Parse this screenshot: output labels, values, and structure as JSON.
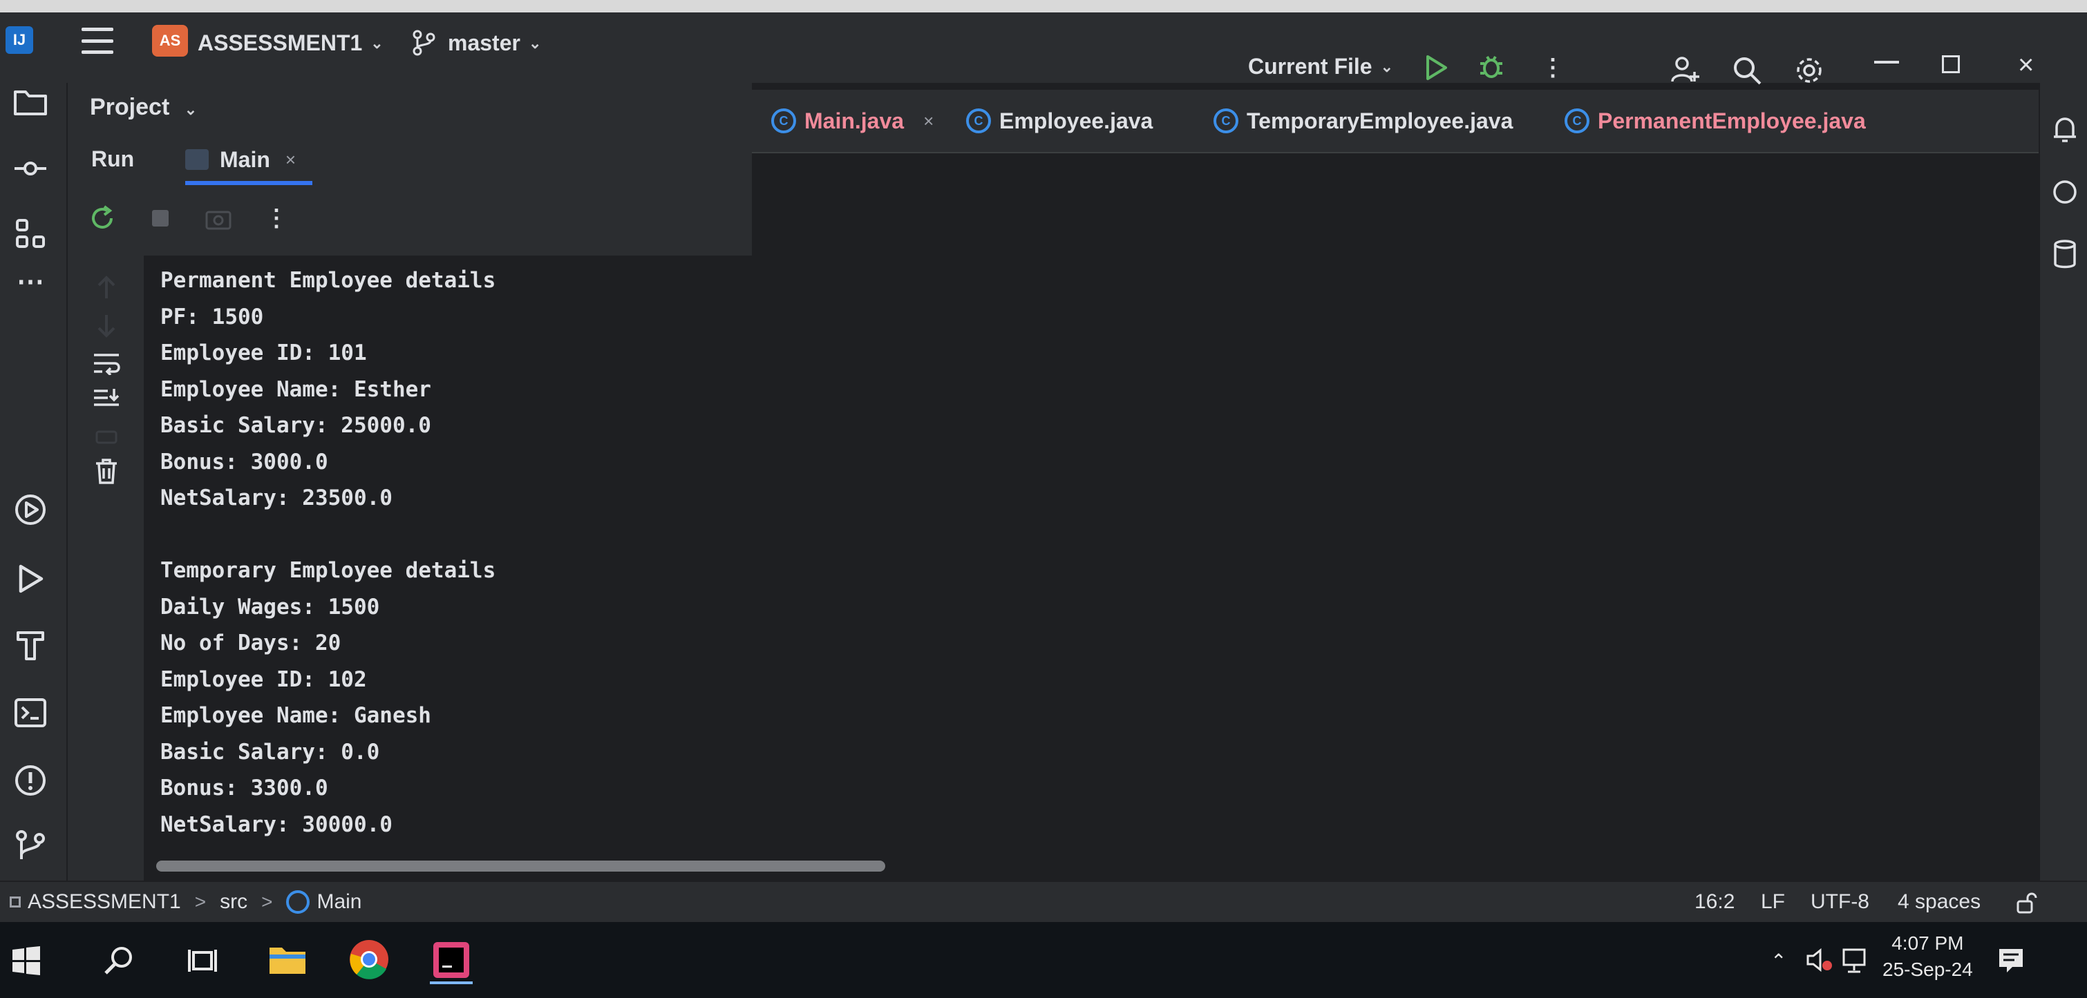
{
  "colors": {
    "background": "#1e1f22",
    "panel": "#2b2d30",
    "accent": "#3574f0",
    "class_icon": "#3c8fe8",
    "project_badge": "#e0673c",
    "run_green": "#5fb865"
  },
  "titlebar": {
    "project_badge": "AS",
    "project_name": "ASSESSMENT1",
    "branch": "master",
    "run_config": "Current File"
  },
  "tool_window": {
    "project_label": "Project",
    "run_label": "Run",
    "run_tab_label": "Main"
  },
  "editor_tabs": [
    {
      "label": "Main.java",
      "close": "×",
      "active": true
    },
    {
      "label": "Employee.java",
      "active": false
    },
    {
      "label": "TemporaryEmployee.java",
      "active": false
    },
    {
      "label": "PermanentEmployee.java",
      "active": false
    }
  ],
  "console": {
    "lines": [
      "Permanent Employee details",
      "PF: 1500",
      "Employee ID: 101",
      "Employee Name: Esther",
      "Basic Salary: 25000.0",
      "Bonus: 3000.0",
      "NetSalary: 23500.0",
      "",
      "Temporary Employee details",
      "Daily Wages: 1500",
      "No of Days: 20",
      "Employee ID: 102",
      "Employee Name: Ganesh",
      "Basic Salary: 0.0",
      "Bonus: 3300.0",
      "NetSalary: 30000.0"
    ]
  },
  "statusbar": {
    "breadcrumb": [
      "ASSESSMENT1",
      "src",
      "Main"
    ],
    "separator": ">",
    "position": "16:2",
    "line_ending": "LF",
    "encoding": "UTF-8",
    "indent": "4 spaces"
  },
  "taskbar": {
    "time": "4:07 PM",
    "date": "25-Sep-24"
  }
}
